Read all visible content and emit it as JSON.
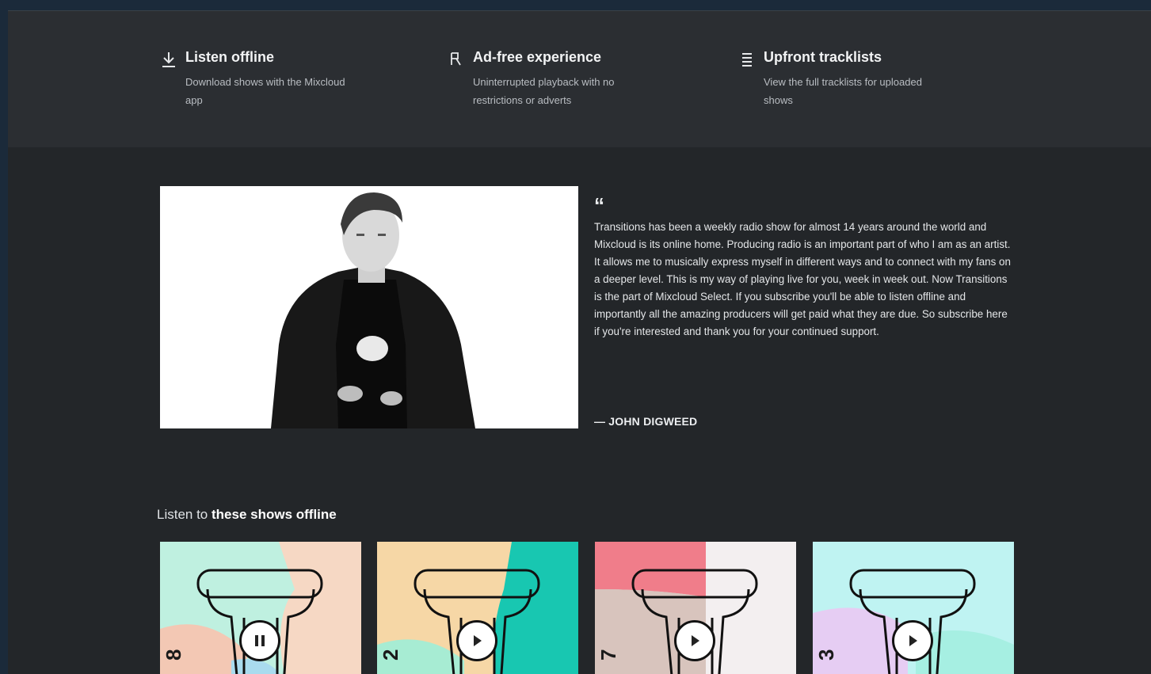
{
  "features": [
    {
      "icon": "download-icon",
      "title": "Listen offline",
      "desc": "Download shows with the Mixcloud app"
    },
    {
      "icon": "ad-free-icon",
      "title": "Ad-free experience",
      "desc": "Uninterrupted playback with no restrictions or adverts"
    },
    {
      "icon": "tracklist-icon",
      "title": "Upfront tracklists",
      "desc": "View the full tracklists for uploaded shows"
    }
  ],
  "quote": {
    "mark": "“",
    "text": "Transitions has been a weekly radio show for almost 14 years around the world and Mixcloud is its online home. Producing radio is an important part of who I am as an artist. It allows me to musically express myself in different ways and to connect with my fans on a deeper level. This is my way of playing live for you, week in week out. Now Transitions is the part of Mixcloud Select. If you subscribe you'll be able to listen offline and importantly all the amazing producers will get paid what they are due. So subscribe here if you're interested and thank you for your continued support.",
    "author": "— JOHN DIGWEED"
  },
  "shows_title": {
    "prefix": "Listen to ",
    "bold": "these shows offline"
  },
  "shows": [
    {
      "number": "8",
      "state": "pause",
      "icon": "pause-icon"
    },
    {
      "number": "2",
      "state": "play",
      "icon": "play-icon"
    },
    {
      "number": "7",
      "state": "play",
      "icon": "play-icon"
    },
    {
      "number": "3",
      "state": "play",
      "icon": "play-icon"
    }
  ],
  "colors": {
    "background": "#232629",
    "features_band": "#2b2e32",
    "page_border": "#1b2a3a"
  }
}
